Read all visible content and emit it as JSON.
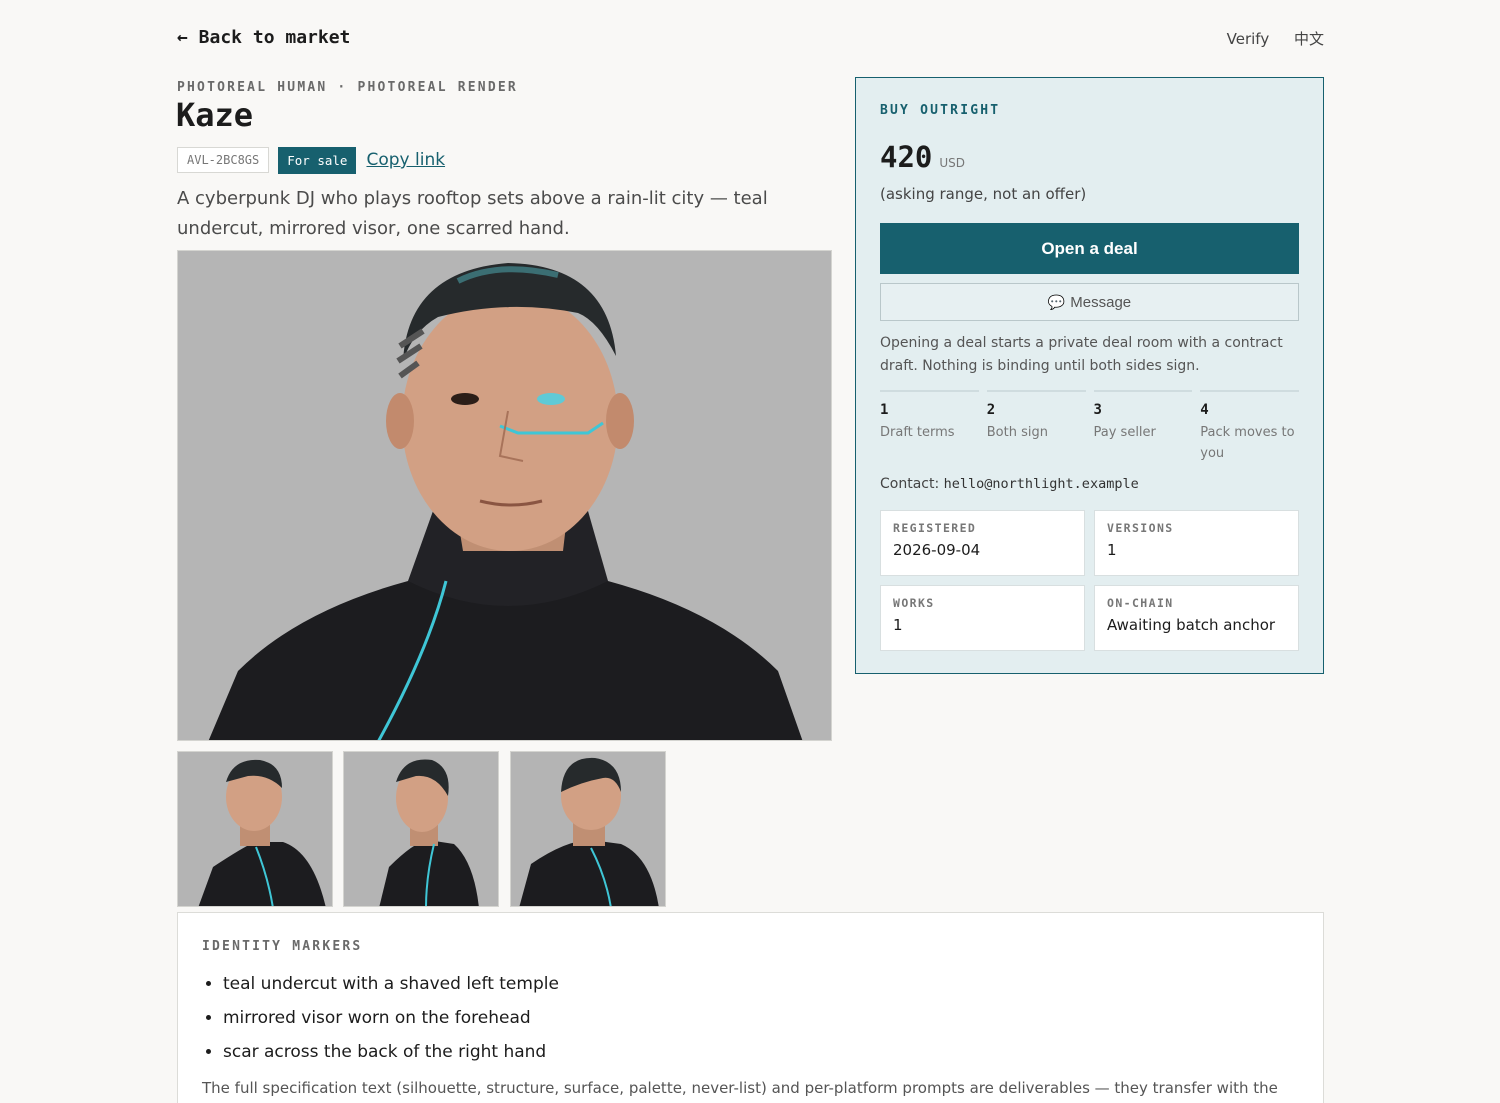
{
  "nav": {
    "back_label": "← Back to market",
    "verify_label": "Verify",
    "language_label": "中文"
  },
  "listing": {
    "eyebrow": "PHOTOREAL HUMAN · PHOTOREAL RENDER",
    "title": "Kaze",
    "id": "AVL-2BC8GS",
    "status_badge": "For sale",
    "copy_link_label": "Copy link",
    "description": "A cyberpunk DJ who plays rooftop sets above a rain-lit city — teal undercut, mirrored visor, one scarred hand."
  },
  "deal": {
    "heading": "BUY OUTRIGHT",
    "price": "420",
    "currency": "USD",
    "price_note": "(asking range, not an offer)",
    "open_deal_label": "Open a deal",
    "message_label": "Message",
    "message_icon": "speech-bubble-icon",
    "note": "Opening a deal starts a private deal room with a contract draft. Nothing is binding until both sides sign.",
    "steps": [
      {
        "num": "1",
        "label": "Draft terms"
      },
      {
        "num": "2",
        "label": "Both sign"
      },
      {
        "num": "3",
        "label": "Pay seller"
      },
      {
        "num": "4",
        "label": "Pack moves to you"
      }
    ],
    "contact_label": "Contact:",
    "contact_email": "hello@northlight.example",
    "stats": [
      {
        "label": "REGISTERED",
        "value": "2026-09-04"
      },
      {
        "label": "VERSIONS",
        "value": "1"
      },
      {
        "label": "WORKS",
        "value": "1"
      },
      {
        "label": "ON-CHAIN",
        "value": "Awaiting batch anchor"
      }
    ]
  },
  "markers": {
    "heading": "IDENTITY MARKERS",
    "items": [
      "teal undercut with a shaved left temple",
      "mirrored visor worn on the forehead",
      "scar across the back of the right hand"
    ],
    "footnote": "The full specification text (silhouette, structure, surface, palette, never-list) and per-platform prompts are deliverables — they transfer with the"
  },
  "colors": {
    "accent": "#17606e",
    "panel_bg": "#e3eef0",
    "page_bg": "#f9f8f6",
    "teal_glow": "#3fc6d6"
  }
}
